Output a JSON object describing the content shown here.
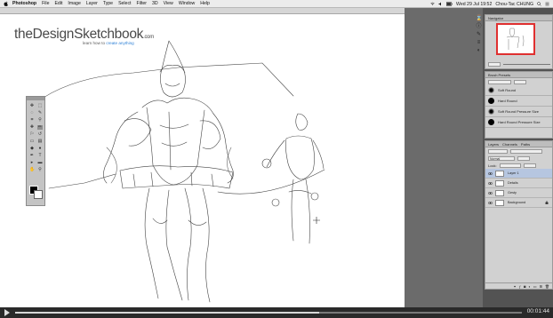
{
  "menubar": {
    "items": [
      "Photoshop",
      "File",
      "Edit",
      "Image",
      "Layer",
      "Type",
      "Select",
      "Filter",
      "3D",
      "View",
      "Window",
      "Help"
    ],
    "clock": "Wed 29 Jul  19:52",
    "user": "Chou-Tac CHUNG"
  },
  "canvas": {
    "logo": "theDesignSketchbook",
    "logo_suffix": ".com",
    "tagline_plain": "learn how to ",
    "tagline_accent": "create anything"
  },
  "panels": {
    "navigator_tab": "Navigator",
    "brush_presets_tab": "Brush Presets",
    "brushes": [
      {
        "name": "Soft Round"
      },
      {
        "name": "Hard Round"
      },
      {
        "name": "Soft Round Pressure Size"
      },
      {
        "name": "Hard Round Pressure Size"
      }
    ],
    "layers_tabs": [
      "Layers",
      "Channels",
      "Paths"
    ],
    "layer_kind": "Normal",
    "lock_label": "Lock:",
    "layers": [
      {
        "name": "Layer 1",
        "selected": true
      },
      {
        "name": "Details",
        "selected": false
      },
      {
        "name": "Gesty",
        "selected": false
      },
      {
        "name": "Background",
        "selected": false
      }
    ]
  },
  "video": {
    "time": "00:01:44",
    "progress": 0.6
  },
  "colors": {
    "selection": "#b6c6e0",
    "navigator_frame": "#e03030",
    "tagline_accent": "#2b7fd6"
  }
}
